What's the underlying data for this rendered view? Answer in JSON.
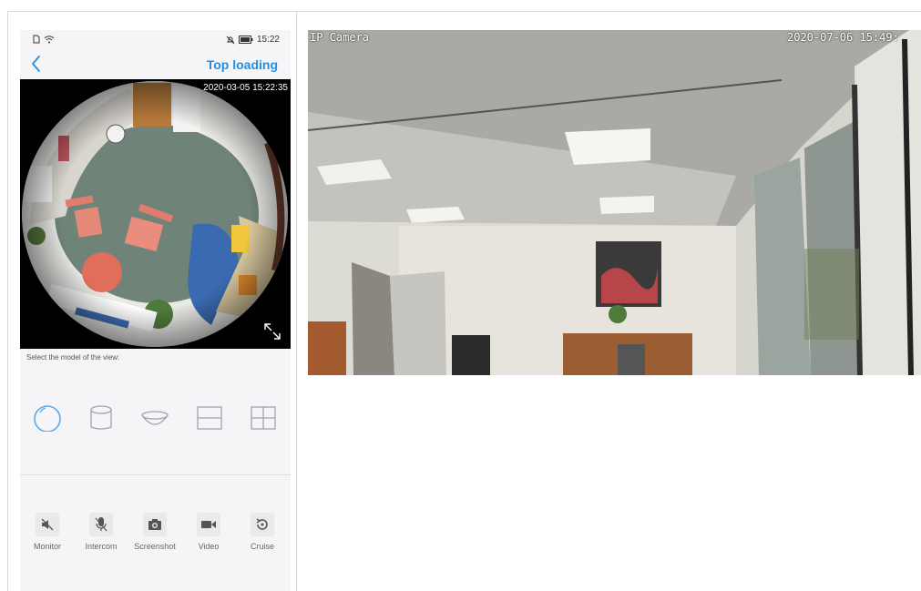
{
  "phone": {
    "status": {
      "time": "15:22"
    },
    "nav": {
      "title": "Top loading"
    },
    "feed": {
      "timestamp": "2020-03-05 15:22:35"
    },
    "view_modes": {
      "label": "Select the model of the view:",
      "items": [
        {
          "icon": "fisheye-circle-icon",
          "selected": true
        },
        {
          "icon": "cylinder-icon",
          "selected": false
        },
        {
          "icon": "bowl-icon",
          "selected": false
        },
        {
          "icon": "split-2-icon",
          "selected": false
        },
        {
          "icon": "split-4-icon",
          "selected": false
        }
      ]
    },
    "actions": [
      {
        "label": "Monitor",
        "icon": "speaker-muted-icon"
      },
      {
        "label": "Intercom",
        "icon": "microphone-icon"
      },
      {
        "label": "Screenshot",
        "icon": "camera-icon"
      },
      {
        "label": "Video",
        "icon": "video-camera-icon"
      },
      {
        "label": "Cruise",
        "icon": "rotate-icon"
      }
    ],
    "colors": {
      "accent": "#1f8ee8",
      "selected_mode": "#5aa7e8",
      "icon": "#9ea3ad"
    }
  },
  "camera": {
    "title": "IP Camera",
    "timestamp": "2020-07-06 15:49:"
  }
}
